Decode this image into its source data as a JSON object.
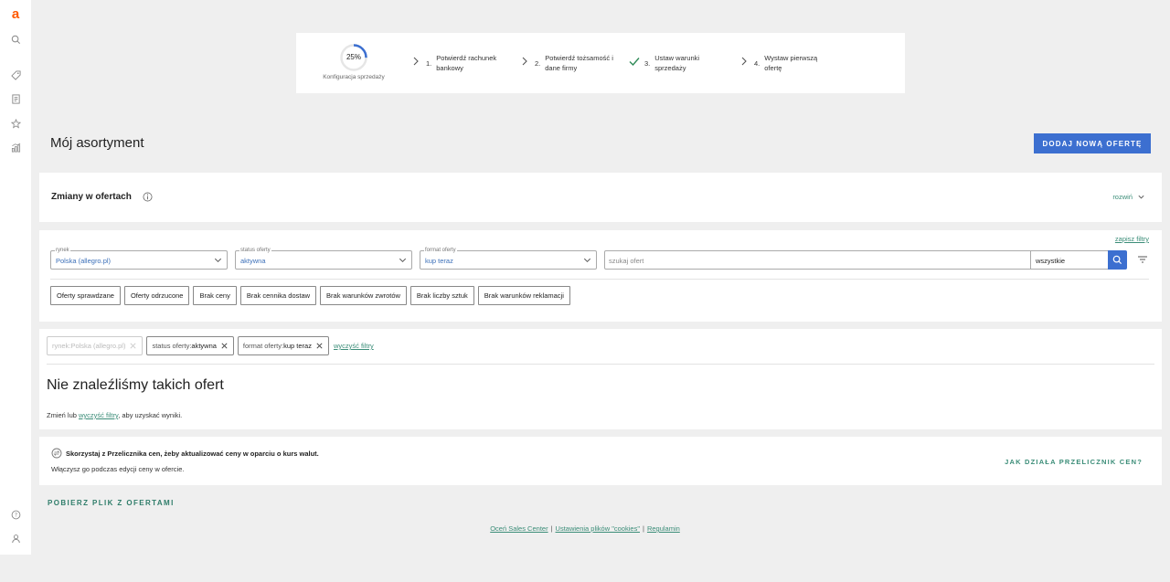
{
  "sidebar": {
    "logo": "a",
    "items": [
      "search-icon",
      "tag-icon",
      "orders-icon",
      "star-icon",
      "stats-icon"
    ],
    "bottom": [
      "help-icon",
      "user-icon"
    ]
  },
  "progress": {
    "percent_label": "25%",
    "percent": 25,
    "caption": "Konfiguracja sprzedaży",
    "steps": [
      {
        "num": "1.",
        "text": "Potwierdź rachunek bankowy",
        "done": false
      },
      {
        "num": "2.",
        "text": "Potwierdź tożsamość i dane firmy",
        "done": false
      },
      {
        "num": "3.",
        "text": "Ustaw warunki sprzedaży",
        "done": true
      },
      {
        "num": "4.",
        "text": "Wystaw pierwszą ofertę",
        "done": false
      }
    ]
  },
  "page": {
    "title": "Mój asortyment",
    "add_button": "DODAJ NOWĄ OFERTĘ"
  },
  "changes": {
    "title": "Zmiany w ofertach",
    "expand_label": "rozwiń"
  },
  "filters": {
    "save_label": "zapisz filtry",
    "market": {
      "label": "rynek",
      "value": "Polska (allegro.pl)"
    },
    "status": {
      "label": "status oferty",
      "value": "aktywna"
    },
    "format": {
      "label": "format oferty",
      "value": "kup teraz"
    },
    "search": {
      "placeholder": "szukaj ofert",
      "scope": "wszystkie"
    },
    "chips": [
      "Oferty sprawdzane",
      "Oferty odrzucone",
      "Brak ceny",
      "Brak cennika dostaw",
      "Brak warunków zwrotów",
      "Brak liczby sztuk",
      "Brak warunków reklamacji"
    ]
  },
  "results": {
    "tags": [
      {
        "key": "rynek: ",
        "value": "Polska (allegro.pl)",
        "disabled": true
      },
      {
        "key": "status oferty: ",
        "value": "aktywna",
        "disabled": false
      },
      {
        "key": "format oferty: ",
        "value": "kup teraz",
        "disabled": false
      }
    ],
    "clear_label": "wyczyść filtry",
    "empty_title": "Nie znaleźliśmy takich ofert",
    "hint_before": "Zmień lub ",
    "hint_link": "wyczyść filtry",
    "hint_after": ", aby uzyskać wyniki."
  },
  "converter": {
    "title": "Skorzystaj z Przelicznika cen, żeby aktualizować ceny w oparciu o kurs walut.",
    "subtitle": "Włączysz go podczas edycji ceny w ofercie.",
    "link": "JAK DZIAŁA PRZELICZNIK CEN?"
  },
  "download_label": "POBIERZ PLIK Z OFERTAMI",
  "footer": {
    "link1": "Oceń Sales Center",
    "link2": "Ustawienia plików \"cookies\"",
    "link3": "Regulamin",
    "sep": "|"
  },
  "colors": {
    "accent_blue": "#3c6fd0",
    "link_green": "#3b8d78",
    "brand_orange": "#ff5a00",
    "background": "#efefef"
  }
}
